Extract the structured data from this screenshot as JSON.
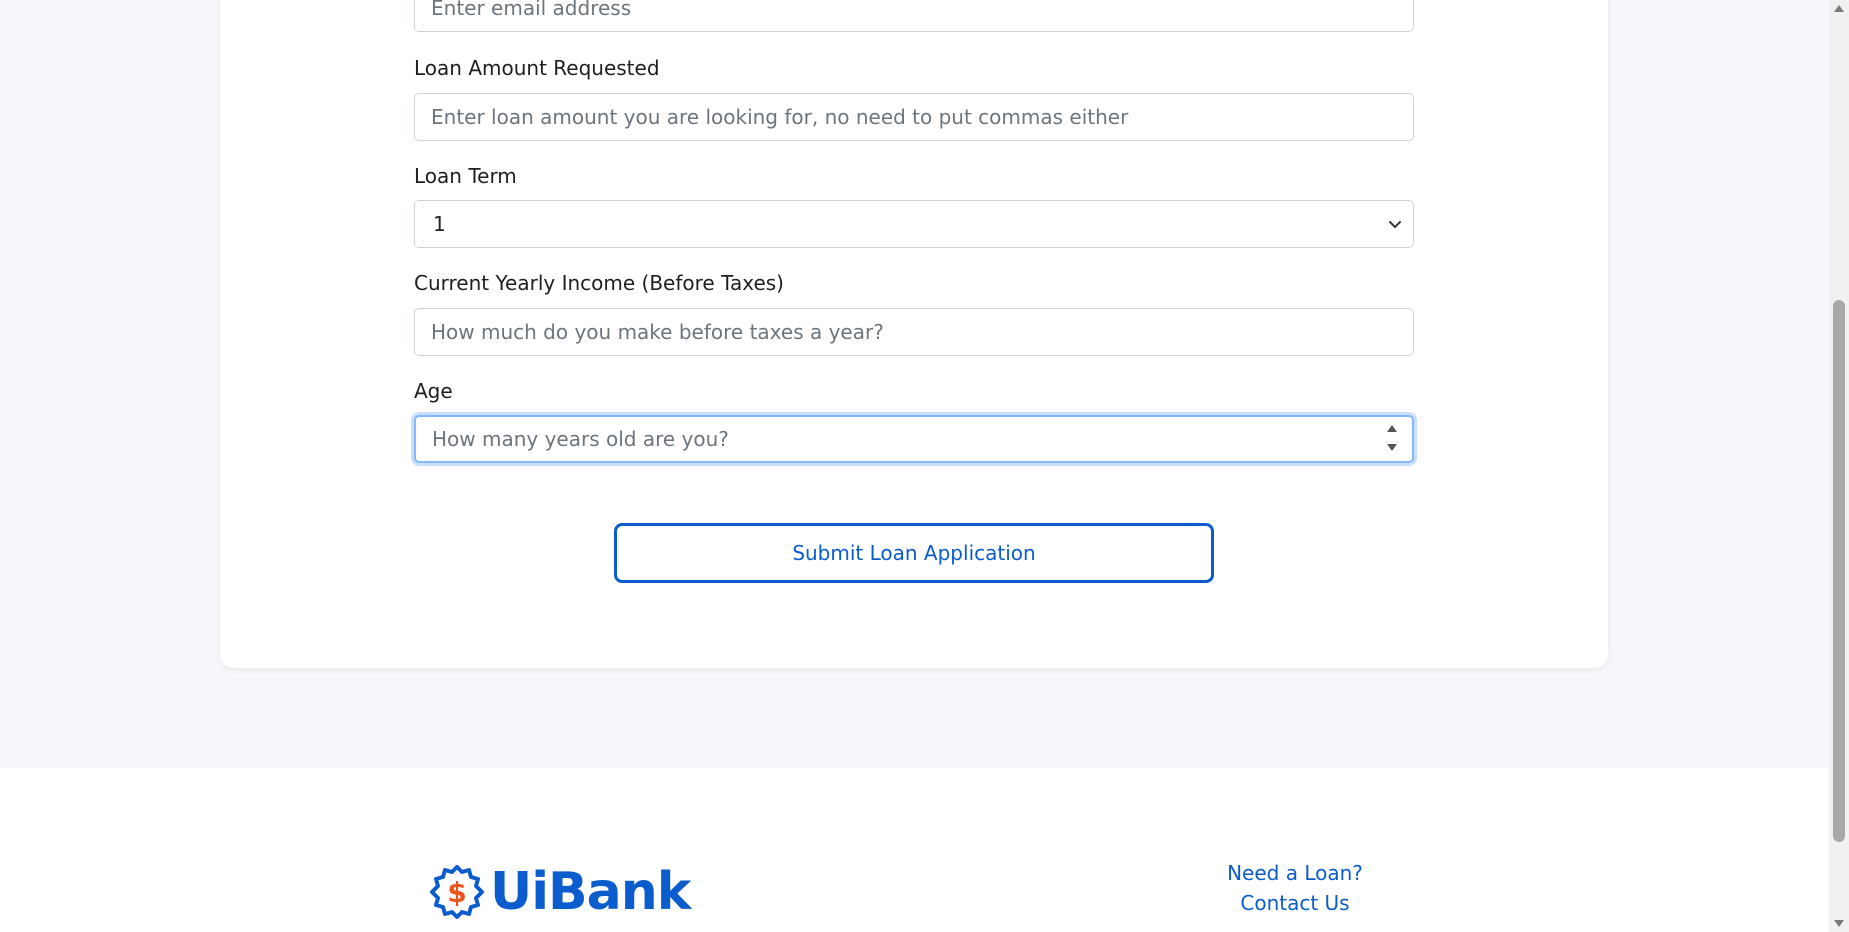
{
  "form": {
    "email": {
      "placeholder": "Enter email address"
    },
    "loan_amount": {
      "label": "Loan Amount Requested",
      "placeholder": "Enter loan amount you are looking for, no need to put commas either"
    },
    "loan_term": {
      "label": "Loan Term",
      "selected": "1"
    },
    "income": {
      "label": "Current Yearly Income (Before Taxes)",
      "placeholder": "How much do you make before taxes a year?"
    },
    "age": {
      "label": "Age",
      "placeholder": "How many years old are you?"
    },
    "submit_label": "Submit Loan Application"
  },
  "footer": {
    "brand": "UiBank",
    "links": [
      "Need a Loan?",
      "Contact Us"
    ]
  },
  "colors": {
    "accent": "#0b5ccc",
    "logo_dollar": "#e8541c",
    "page_bg": "#f6f7fa"
  },
  "icons": {
    "logo": "dollar-gear-icon",
    "select": "chevron-down-icon",
    "spinner": "number-spinner-icon"
  }
}
